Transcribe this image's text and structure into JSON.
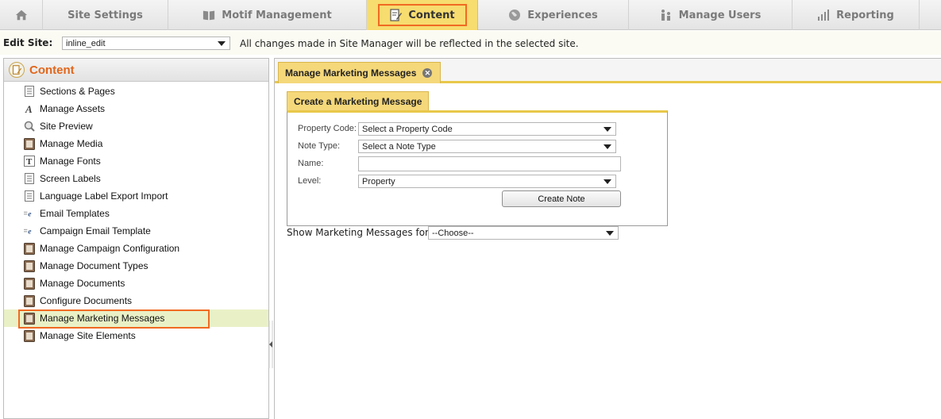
{
  "nav": {
    "home_icon": "home-icon",
    "tabs": [
      {
        "label": "Site Settings",
        "icon": ""
      },
      {
        "label": "Motif Management",
        "icon": "book-icon"
      },
      {
        "label": "Content",
        "icon": "edit-document-icon"
      },
      {
        "label": "Experiences",
        "icon": "globe-icon"
      },
      {
        "label": "Manage Users",
        "icon": "users-icon"
      },
      {
        "label": "Reporting",
        "icon": "bar-chart-icon"
      }
    ],
    "active_tab": "Content"
  },
  "edit_site": {
    "label": "Edit Site:",
    "selected": "inline_edit",
    "message": "All changes made in Site Manager will be reflected in the selected site."
  },
  "sidebar": {
    "title": "Content",
    "items": [
      {
        "label": "Sections & Pages",
        "icon": "page-icon"
      },
      {
        "label": "Manage Assets",
        "icon": "font-a-icon"
      },
      {
        "label": "Site Preview",
        "icon": "magnifier-icon"
      },
      {
        "label": "Manage Media",
        "icon": "media-icon"
      },
      {
        "label": "Manage Fonts",
        "icon": "font-t-icon"
      },
      {
        "label": "Screen Labels",
        "icon": "page-icon"
      },
      {
        "label": "Language Label Export Import",
        "icon": "page-icon"
      },
      {
        "label": "Email Templates",
        "icon": "email-template-icon"
      },
      {
        "label": "Campaign Email Template",
        "icon": "email-template-icon"
      },
      {
        "label": "Manage Campaign Configuration",
        "icon": "media-icon"
      },
      {
        "label": "Manage Document Types",
        "icon": "media-icon"
      },
      {
        "label": "Manage Documents",
        "icon": "media-icon"
      },
      {
        "label": "Configure Documents",
        "icon": "media-icon"
      },
      {
        "label": "Manage Marketing Messages",
        "icon": "media-icon"
      },
      {
        "label": "Manage Site Elements",
        "icon": "media-icon"
      }
    ],
    "active_item": "Manage Marketing Messages"
  },
  "main": {
    "doc_tab": "Manage Marketing Messages",
    "form_tab": "Create a Marketing Message",
    "form": {
      "property_code_label": "Property Code:",
      "property_code_value": "Select a Property Code",
      "note_type_label": "Note Type:",
      "note_type_value": "Select a Note Type",
      "name_label": "Name:",
      "name_value": "",
      "level_label": "Level:",
      "level_value": "Property",
      "create_button": "Create Note"
    },
    "show_label": "Show Marketing Messages for:",
    "show_value": "--Choose--"
  },
  "colors": {
    "accent_orange": "#f06a22",
    "tab_yellow": "#f7dc6f",
    "active_row": "#eaf0c6",
    "title_orange": "#e2661b"
  }
}
